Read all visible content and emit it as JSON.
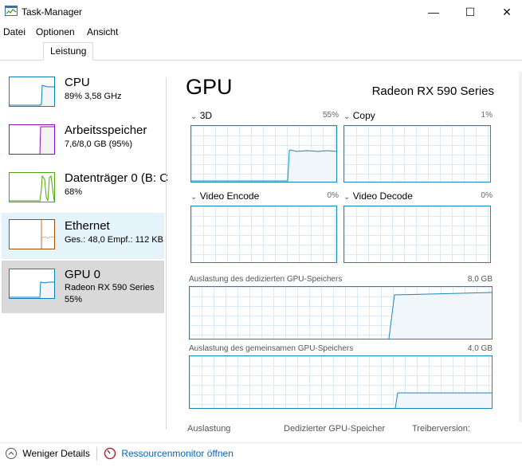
{
  "window": {
    "title": "Task-Manager",
    "minimize": "—",
    "maximize": "☐",
    "close": "✕"
  },
  "menu": [
    "Datei",
    "Optionen",
    "Ansicht"
  ],
  "tabs": [
    "Leistung"
  ],
  "sidebar": [
    {
      "name": "CPU",
      "sub1": "89%  3,58 GHz",
      "sub2": "",
      "color": "#117dbb"
    },
    {
      "name": "Arbeitsspeicher",
      "sub1": "7,6/8,0 GB (95%)",
      "sub2": "",
      "color": "#8b12ae"
    },
    {
      "name": "Datenträger 0 (B: C",
      "sub1": "68%",
      "sub2": "",
      "color": "#4da60c"
    },
    {
      "name": "Ethernet",
      "sub1": "Ges.: 48,0  Empf.: 112 KB",
      "sub2": "",
      "color": "#a74f01"
    },
    {
      "name": "GPU 0",
      "sub1": "Radeon RX 590 Series",
      "sub2": "55%",
      "color": "#117dbb"
    }
  ],
  "main": {
    "title": "GPU",
    "adapter": "Radeon RX 590 Series",
    "engines": [
      {
        "label": "3D",
        "pct": "55%"
      },
      {
        "label": "Copy",
        "pct": "1%"
      },
      {
        "label": "Video Encode",
        "pct": "0%"
      },
      {
        "label": "Video Decode",
        "pct": "0%"
      }
    ],
    "dedicated": {
      "label": "Auslastung des dedizierten GPU-Speichers",
      "max": "8,0 GB"
    },
    "shared": {
      "label": "Auslastung des gemeinsamen GPU-Speichers",
      "max": "4,0 GB"
    },
    "stats": [
      "Auslastung",
      "Dedizierter GPU-Speicher",
      "Treiberversion:"
    ]
  },
  "footer": {
    "fewer_details": "Weniger Details",
    "resource_monitor": "Ressourcenmonitor öffnen"
  },
  "colors": {
    "gpu_line": "#1a87b9",
    "gpu_fill": "#f1f6fa",
    "grid": "#d6ebf6",
    "link": "#0066cc"
  }
}
